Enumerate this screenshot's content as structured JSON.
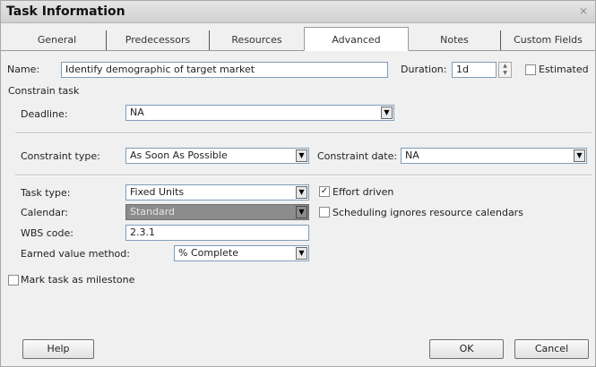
{
  "dialog": {
    "title": "Task Information",
    "close_icon": "help-close-icon"
  },
  "tabs": [
    {
      "label": "General"
    },
    {
      "label": "Predecessors"
    },
    {
      "label": "Resources"
    },
    {
      "label": "Advanced",
      "active": true
    },
    {
      "label": "Notes"
    },
    {
      "label": "Custom Fields"
    }
  ],
  "name": {
    "label": "Name:",
    "value": "Identify demographic of target market"
  },
  "duration": {
    "label": "Duration:",
    "value": "1d"
  },
  "estimated": {
    "label": "Estimated",
    "checked": false
  },
  "constrain_task": {
    "heading": "Constrain task"
  },
  "deadline": {
    "label": "Deadline:",
    "value": "NA"
  },
  "constraint_type": {
    "label": "Constraint type:",
    "value": "As Soon As Possible"
  },
  "constraint_date": {
    "label": "Constraint date:",
    "value": "NA"
  },
  "task_type": {
    "label": "Task type:",
    "value": "Fixed Units"
  },
  "effort_driven": {
    "label": "Effort driven",
    "checked": true
  },
  "calendar": {
    "label": "Calendar:",
    "value": "Standard"
  },
  "scheduling_ignores": {
    "label": "Scheduling ignores resource calendars",
    "checked": false
  },
  "wbs": {
    "label": "WBS code:",
    "value": "2.3.1"
  },
  "earned_value": {
    "label": "Earned value method:",
    "value": "% Complete"
  },
  "milestone": {
    "label": "Mark task as milestone",
    "checked": false
  },
  "buttons": {
    "help": "Help",
    "ok": "OK",
    "cancel": "Cancel"
  }
}
